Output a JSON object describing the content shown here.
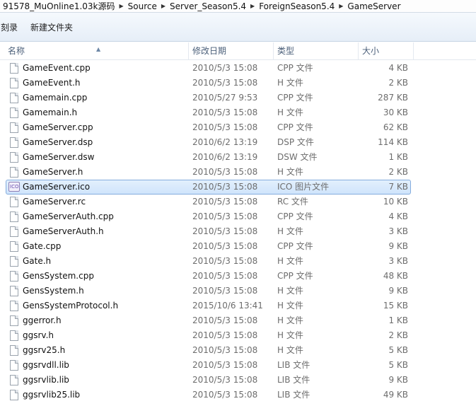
{
  "breadcrumb": [
    "91578_MuOnline1.03k源码",
    "Source",
    "Server_Season5.4",
    "ForeignSeason5.4",
    "GameServer"
  ],
  "toolbar": {
    "burn": "刻录",
    "new_folder": "新建文件夹"
  },
  "columns": {
    "name": "名称",
    "date": "修改日期",
    "type": "类型",
    "size": "大小"
  },
  "files": [
    {
      "name": "GameEvent.cpp",
      "date": "2010/5/3 15:08",
      "type": "CPP 文件",
      "size": "4 KB"
    },
    {
      "name": "GameEvent.h",
      "date": "2010/5/3 15:08",
      "type": "H 文件",
      "size": "2 KB"
    },
    {
      "name": "Gamemain.cpp",
      "date": "2010/5/27 9:53",
      "type": "CPP 文件",
      "size": "287 KB"
    },
    {
      "name": "Gamemain.h",
      "date": "2010/5/3 15:08",
      "type": "H 文件",
      "size": "30 KB"
    },
    {
      "name": "GameServer.cpp",
      "date": "2010/5/3 15:08",
      "type": "CPP 文件",
      "size": "62 KB"
    },
    {
      "name": "GameServer.dsp",
      "date": "2010/6/2 13:19",
      "type": "DSP 文件",
      "size": "114 KB"
    },
    {
      "name": "GameServer.dsw",
      "date": "2010/6/2 13:19",
      "type": "DSW 文件",
      "size": "1 KB"
    },
    {
      "name": "GameServer.h",
      "date": "2010/5/3 15:08",
      "type": "H 文件",
      "size": "2 KB"
    },
    {
      "name": "GameServer.ico",
      "date": "2010/5/3 15:08",
      "type": "ICO 图片文件",
      "size": "7 KB",
      "selected": true,
      "icon": "ico-file-icon"
    },
    {
      "name": "GameServer.rc",
      "date": "2010/5/3 15:08",
      "type": "RC 文件",
      "size": "10 KB"
    },
    {
      "name": "GameServerAuth.cpp",
      "date": "2010/5/3 15:08",
      "type": "CPP 文件",
      "size": "4 KB"
    },
    {
      "name": "GameServerAuth.h",
      "date": "2010/5/3 15:08",
      "type": "H 文件",
      "size": "3 KB"
    },
    {
      "name": "Gate.cpp",
      "date": "2010/5/3 15:08",
      "type": "CPP 文件",
      "size": "9 KB"
    },
    {
      "name": "Gate.h",
      "date": "2010/5/3 15:08",
      "type": "H 文件",
      "size": "3 KB"
    },
    {
      "name": "GensSystem.cpp",
      "date": "2010/5/3 15:08",
      "type": "CPP 文件",
      "size": "48 KB"
    },
    {
      "name": "GensSystem.h",
      "date": "2010/5/3 15:08",
      "type": "H 文件",
      "size": "9 KB"
    },
    {
      "name": "GensSystemProtocol.h",
      "date": "2015/10/6 13:41",
      "type": "H 文件",
      "size": "15 KB"
    },
    {
      "name": "ggerror.h",
      "date": "2010/5/3 15:08",
      "type": "H 文件",
      "size": "1 KB"
    },
    {
      "name": "ggsrv.h",
      "date": "2010/5/3 15:08",
      "type": "H 文件",
      "size": "2 KB"
    },
    {
      "name": "ggsrv25.h",
      "date": "2010/5/3 15:08",
      "type": "H 文件",
      "size": "5 KB"
    },
    {
      "name": "ggsrvdll.lib",
      "date": "2010/5/3 15:08",
      "type": "LIB 文件",
      "size": "5 KB"
    },
    {
      "name": "ggsrvlib.lib",
      "date": "2010/5/3 15:08",
      "type": "LIB 文件",
      "size": "9 KB"
    },
    {
      "name": "ggsrvlib25.lib",
      "date": "2010/5/3 15:08",
      "type": "LIB 文件",
      "size": "49 KB"
    }
  ],
  "ico_badge": "ICO",
  "icons": {
    "file": "document-icon",
    "sort": "sort-ascending-icon",
    "separator": "breadcrumb-arrow-icon"
  },
  "colors": {
    "selection": "#cfe4fb",
    "selection_border": "#84acdd",
    "header_text": "#4c607a",
    "meta_text": "#6d6d6d"
  }
}
